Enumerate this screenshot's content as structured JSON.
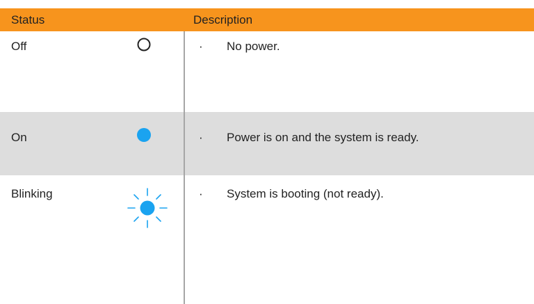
{
  "header": {
    "status": "Status",
    "description": "Description"
  },
  "rows": [
    {
      "status": "Off",
      "bullet": "·",
      "description": "No power.",
      "icon": "led-off-icon"
    },
    {
      "status": "On",
      "bullet": "·",
      "description": "Power is on and the system is ready.",
      "icon": "led-on-icon"
    },
    {
      "status": "Blinking",
      "bullet": "·",
      "description": "System is booting (not ready).",
      "icon": "led-blinking-icon"
    }
  ],
  "colors": {
    "header_bg": "#f7941d",
    "highlight_row_bg": "#dddddd",
    "led_blue": "#1aa3f0",
    "divider": "#a6a6a6"
  }
}
